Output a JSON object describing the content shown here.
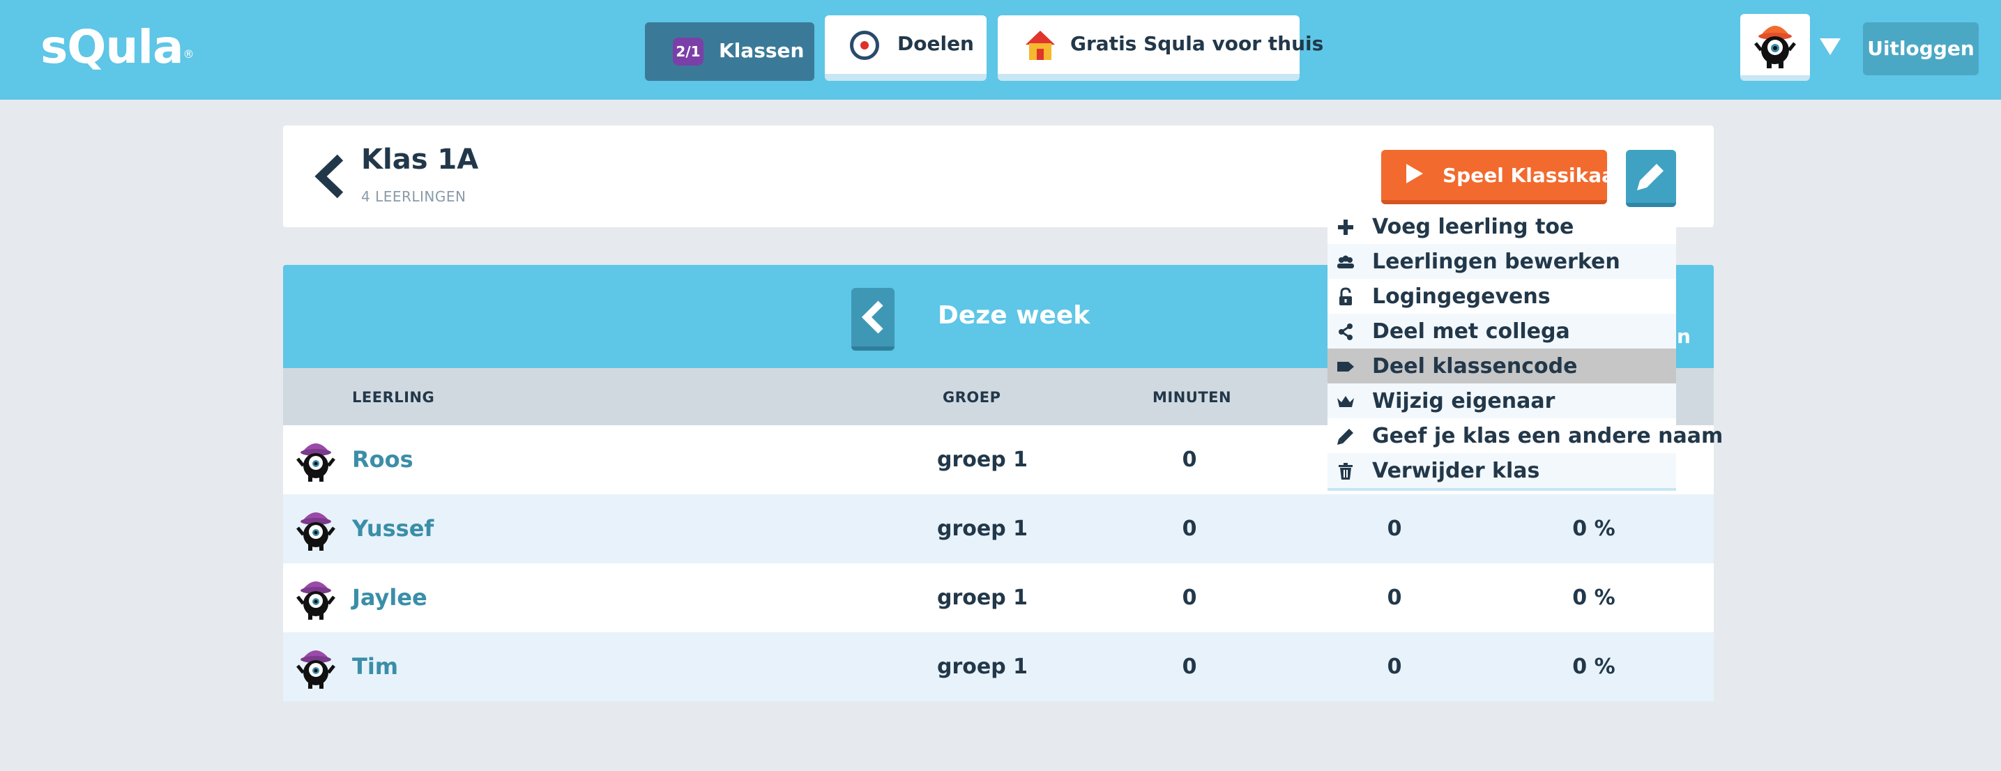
{
  "header": {
    "logo": "sQula",
    "logo_mark": "®",
    "nav": [
      {
        "label": "Klassen",
        "icon": "klassen-icon",
        "active": true
      },
      {
        "label": "Doelen",
        "icon": "target-icon",
        "active": false
      },
      {
        "label": "Gratis Squla voor thuis",
        "icon": "house-icon",
        "active": false
      }
    ],
    "avatar_icon": "monster-avatar-icon",
    "logout_label": "Uitloggen"
  },
  "class": {
    "title": "Klas 1A",
    "subtitle": "4 LEERLINGEN",
    "play_label": "Speel Klassikaal"
  },
  "week": {
    "label": "Deze week",
    "right_partial": "en"
  },
  "table": {
    "columns": [
      "LEERLING",
      "GROEP",
      "MINUTEN"
    ],
    "rows": [
      {
        "name": "Roos",
        "group": "groep 1",
        "minutes": "0",
        "col4": "",
        "col5": ""
      },
      {
        "name": "Yussef",
        "group": "groep 1",
        "minutes": "0",
        "col4": "0",
        "col5": "0 %"
      },
      {
        "name": "Jaylee",
        "group": "groep 1",
        "minutes": "0",
        "col4": "0",
        "col5": "0 %"
      },
      {
        "name": "Tim",
        "group": "groep 1",
        "minutes": "0",
        "col4": "0",
        "col5": "0 %"
      }
    ]
  },
  "menu": {
    "items": [
      {
        "label": "Voeg leerling toe",
        "icon": "plus-icon"
      },
      {
        "label": "Leerlingen bewerken",
        "icon": "users-icon"
      },
      {
        "label": "Logingegevens",
        "icon": "lock-icon"
      },
      {
        "label": "Deel met collega",
        "icon": "share-icon"
      },
      {
        "label": "Deel klassencode",
        "icon": "tag-icon",
        "highlighted": true
      },
      {
        "label": "Wijzig eigenaar",
        "icon": "crown-icon"
      },
      {
        "label": "Geef je klas een andere naam",
        "icon": "pencil-icon"
      },
      {
        "label": "Verwijder klas",
        "icon": "trash-icon"
      }
    ]
  },
  "colors": {
    "header_bg": "#5ec6e6",
    "active_nav": "#3a7a98",
    "play_orange": "#f26a2e",
    "text_dark": "#22384a",
    "name_teal": "#3a8ea8"
  }
}
